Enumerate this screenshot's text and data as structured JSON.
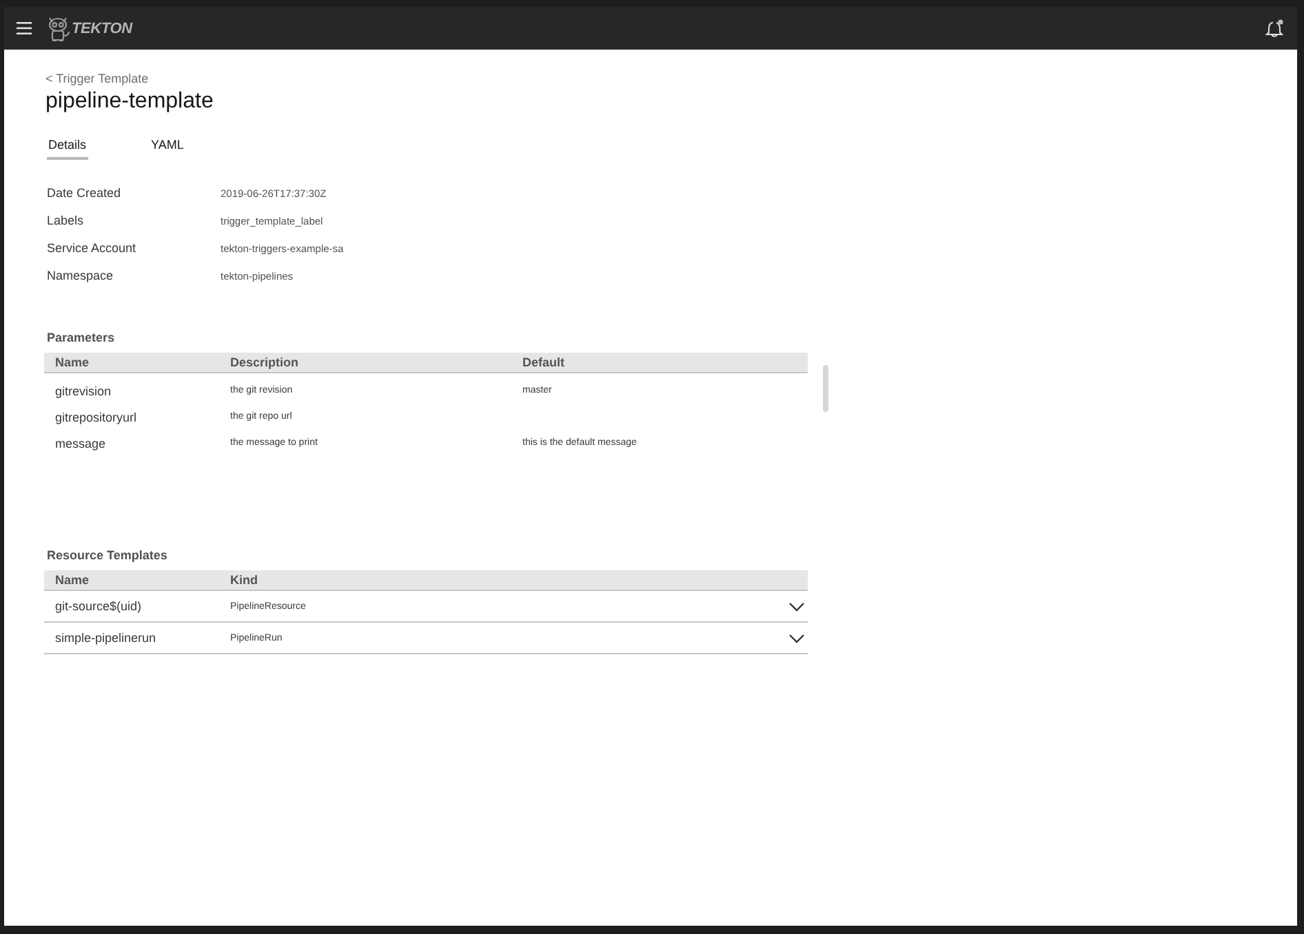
{
  "header": {
    "brand": "TEKTON",
    "notifications": {
      "unread": true
    }
  },
  "breadcrumb": "< Trigger Template",
  "title": "pipeline-template",
  "tabs": [
    {
      "label": "Details",
      "selected": true
    },
    {
      "label": "YAML",
      "selected": false
    }
  ],
  "details": [
    {
      "label": "Date Created",
      "value": "2019-06-26T17:37:30Z"
    },
    {
      "label": "Labels",
      "value": "trigger_template_label"
    },
    {
      "label": "Service Account",
      "value": "tekton-triggers-example-sa"
    },
    {
      "label": "Namespace",
      "value": "tekton-pipelines"
    }
  ],
  "parameters": {
    "title": "Parameters",
    "columns": [
      "Name",
      "Description",
      "Default"
    ],
    "rows": [
      {
        "name": "gitrevision",
        "description": "the git revision",
        "default": "master"
      },
      {
        "name": "gitrepositoryurl",
        "description": "the git repo url"
      },
      {
        "name": "message",
        "description": "the message to print",
        "default": "this is the default message"
      }
    ]
  },
  "resource_templates": {
    "title": "Resource Templates",
    "columns": [
      "Name",
      "Kind"
    ],
    "rows": [
      {
        "name": "git-source$(uid)",
        "resource_kind": "PipelineResource",
        "expanded": false
      },
      {
        "name": "simple-pipelinerun",
        "resource_kind": "PipelineRun",
        "expanded": false
      }
    ]
  }
}
